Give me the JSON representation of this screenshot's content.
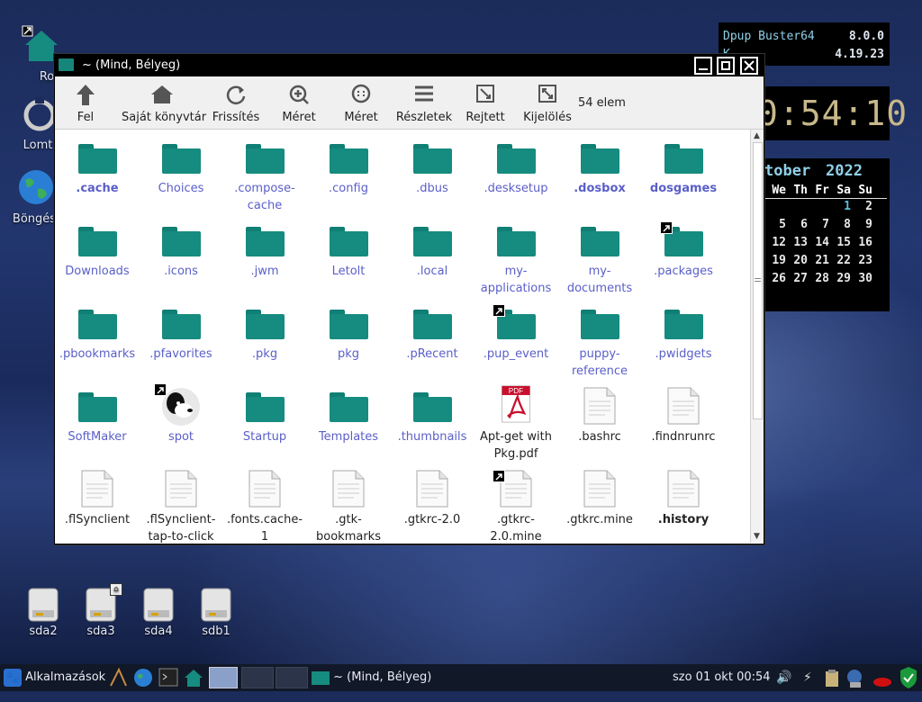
{
  "desktop": {
    "icons": [
      {
        "label": "Roo",
        "icon": "home-folder-icon"
      },
      {
        "label": "Lomt",
        "icon": "trash-icon"
      },
      {
        "label": "Böngés",
        "icon": "browser-globe-icon"
      }
    ],
    "drives": [
      {
        "label": "sda2"
      },
      {
        "label": "sda3",
        "badge": "home-badge-icon"
      },
      {
        "label": "sda4"
      },
      {
        "label": "sdb1"
      }
    ]
  },
  "conky": {
    "distro": "Dpup Buster64",
    "distro_version": "8.0.0",
    "kernel_label": "K",
    "kernel_version": "4.19.23",
    "clock": "0:54:10",
    "calendar": {
      "title": "tober",
      "year": "2022",
      "weekdays": [
        "We",
        "Th",
        "Fr",
        "Sa",
        "Su"
      ],
      "weeks": [
        [
          "",
          "",
          "",
          "1",
          "2"
        ],
        [
          "5",
          "6",
          "7",
          "8",
          "9"
        ],
        [
          "12",
          "13",
          "14",
          "15",
          "16"
        ],
        [
          "19",
          "20",
          "21",
          "22",
          "23"
        ],
        [
          "26",
          "27",
          "28",
          "29",
          "30"
        ]
      ],
      "today": "1",
      "accent": "#5bc0de"
    }
  },
  "window": {
    "title": "~ (Mind, Bélyeg)",
    "buttons": {
      "minimize": "minimize-icon",
      "maximize": "maximize-icon",
      "close": "close-icon"
    },
    "toolbar": [
      {
        "label": "Fel",
        "icon": "arrow-up-icon"
      },
      {
        "label": "Saját könyvtár",
        "icon": "home-icon"
      },
      {
        "label": "Frissítés",
        "icon": "refresh-icon"
      },
      {
        "label": "Méret",
        "icon": "zoom-in-icon"
      },
      {
        "label": "Méret",
        "icon": "zoom-out-icon"
      },
      {
        "label": "Részletek",
        "icon": "list-icon"
      },
      {
        "label": "Rejtett",
        "icon": "hidden-files-icon"
      },
      {
        "label": "Kijelölés",
        "icon": "select-icon"
      }
    ],
    "item_count": "54 elem",
    "folder_color": "#168b7f",
    "link_color": "#5a5fc8",
    "items": [
      {
        "name": ".cache",
        "type": "folder",
        "bold": true
      },
      {
        "name": "Choices",
        "type": "folder"
      },
      {
        "name": ".compose-cache",
        "type": "folder"
      },
      {
        "name": ".config",
        "type": "folder"
      },
      {
        "name": ".dbus",
        "type": "folder"
      },
      {
        "name": ".desksetup",
        "type": "folder"
      },
      {
        "name": ".dosbox",
        "type": "folder",
        "bold": true
      },
      {
        "name": "dosgames",
        "type": "folder",
        "bold": true
      },
      {
        "name": "Downloads",
        "type": "folder"
      },
      {
        "name": ".icons",
        "type": "folder"
      },
      {
        "name": ".jwm",
        "type": "folder"
      },
      {
        "name": "Letolt",
        "type": "folder"
      },
      {
        "name": ".local",
        "type": "folder"
      },
      {
        "name": "my-applications",
        "type": "folder"
      },
      {
        "name": "my-documents",
        "type": "folder"
      },
      {
        "name": ".packages",
        "type": "folder",
        "link": true
      },
      {
        "name": ".pbookmarks",
        "type": "folder"
      },
      {
        "name": ".pfavorites",
        "type": "folder"
      },
      {
        "name": ".pkg",
        "type": "folder"
      },
      {
        "name": "pkg",
        "type": "folder"
      },
      {
        "name": ".pRecent",
        "type": "folder"
      },
      {
        "name": ".pup_event",
        "type": "folder",
        "link": true
      },
      {
        "name": "puppy-reference",
        "type": "folder"
      },
      {
        "name": ".pwidgets",
        "type": "folder"
      },
      {
        "name": "SoftMaker",
        "type": "folder"
      },
      {
        "name": "spot",
        "type": "spot",
        "link": true
      },
      {
        "name": "Startup",
        "type": "folder"
      },
      {
        "name": "Templates",
        "type": "folder"
      },
      {
        "name": ".thumbnails",
        "type": "folder"
      },
      {
        "name": "Apt-get with Pkg.pdf",
        "type": "pdf",
        "dark": true,
        "pdf_label": "PDF"
      },
      {
        "name": ".bashrc",
        "type": "file",
        "dark": true
      },
      {
        "name": ".findnrunrc",
        "type": "file",
        "dark": true
      },
      {
        "name": ".flSynclient",
        "type": "file",
        "dark": true
      },
      {
        "name": ".flSynclient-tap-to-click",
        "type": "file",
        "dark": true
      },
      {
        "name": ".fonts.cache-1",
        "type": "file",
        "dark": true
      },
      {
        "name": ".gtk-bookmarks",
        "type": "file",
        "dark": true
      },
      {
        "name": ".gtkrc-2.0",
        "type": "file",
        "dark": true
      },
      {
        "name": ".gtkrc-2.0.mine",
        "type": "file",
        "dark": true,
        "link": true
      },
      {
        "name": ".gtkrc.mine",
        "type": "file",
        "dark": true
      },
      {
        "name": ".history",
        "type": "file",
        "dark": true,
        "bold": true
      }
    ]
  },
  "taskbar": {
    "menu_label": "Alkalmazások",
    "window_button": "~ (Mind, Bélyeg)",
    "clock": "szo 01 okt 00:54"
  }
}
